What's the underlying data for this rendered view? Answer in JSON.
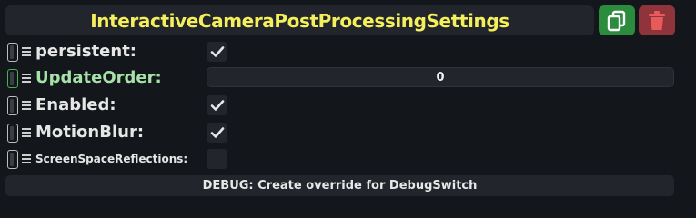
{
  "header": {
    "title": "InteractiveCameraPostProcessingSettings",
    "copy_icon": "copy-icon",
    "delete_icon": "trash-icon",
    "title_color": "#f5ef5c",
    "copy_color": "#2b8c3d",
    "delete_color": "#8f343a"
  },
  "fields": [
    {
      "label": "persistent:",
      "type": "checkbox",
      "checked": true
    },
    {
      "label": "UpdateOrder:",
      "type": "number",
      "value": "0",
      "highlighted": true
    },
    {
      "label": "Enabled:",
      "type": "checkbox",
      "checked": true
    },
    {
      "label": "MotionBlur:",
      "type": "checkbox",
      "checked": true
    },
    {
      "label": "ScreenSpaceReflections:",
      "type": "checkbox",
      "checked": false
    }
  ],
  "footer": {
    "debug_label": "DEBUG: Create override for DebugSwitch"
  }
}
